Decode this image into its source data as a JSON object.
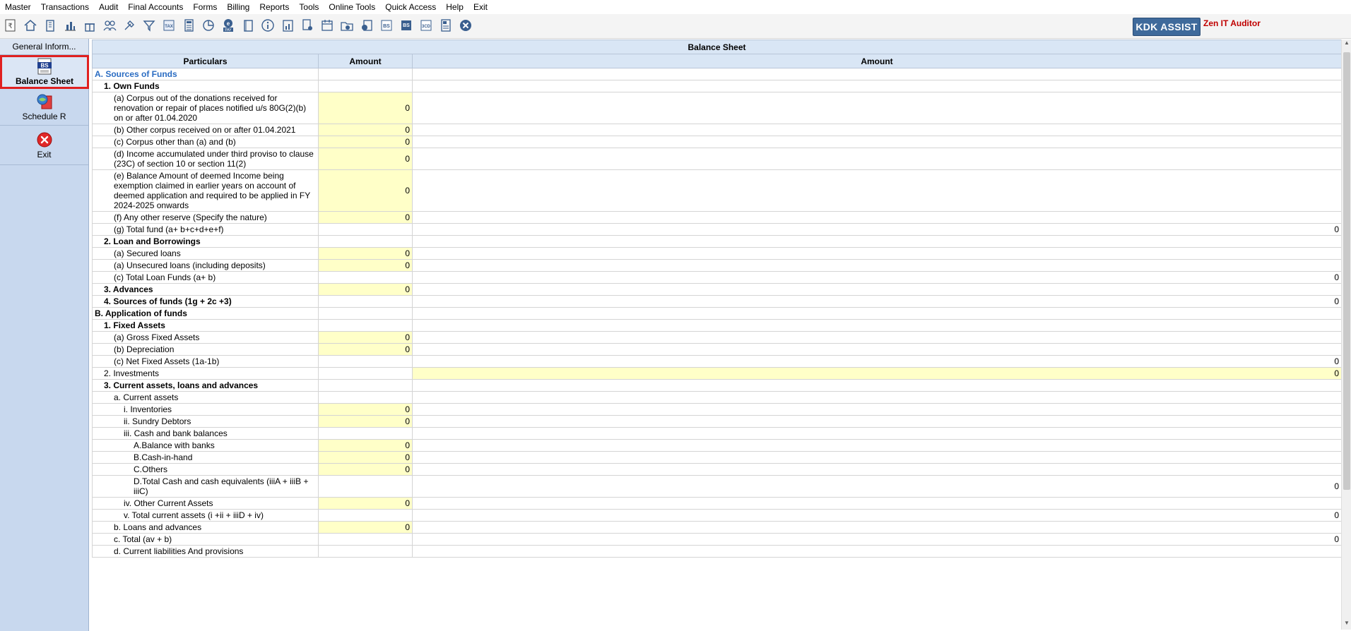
{
  "menu": [
    "Master",
    "Transactions",
    "Audit",
    "Final Accounts",
    "Forms",
    "Billing",
    "Reports",
    "Tools",
    "Online Tools",
    "Quick Access",
    "Help",
    "Exit"
  ],
  "toolbar": {
    "icons": [
      "rupee-doc-icon",
      "home-icon",
      "building-icon",
      "bar-chart-icon",
      "gift-icon",
      "people-icon",
      "tools-icon",
      "filter-icon",
      "tax-icon",
      "calculator-icon",
      "pie-chart-icon",
      "epay-icon",
      "book-icon",
      "info-icon",
      "report-icon",
      "doc-user-icon",
      "calendar-icon",
      "folder-add-icon",
      "refresh-doc-icon",
      "bs-icon",
      "bs-form-icon",
      "3cd-icon",
      "form-icon",
      "close-circle-icon"
    ],
    "tax_text": "TAX",
    "pay_text": "PAY",
    "bs_text": "BS",
    "cd_text": "3CD",
    "kdk_assist": "KDK ASSIST",
    "zen_label": "Zen IT Auditor"
  },
  "sidebar": {
    "header": "General Inform...",
    "items": [
      {
        "label": "Balance Sheet",
        "icon": "balance-sheet-icon",
        "active": true
      },
      {
        "label": "Schedule R",
        "icon": "schedule-r-icon",
        "active": false
      },
      {
        "label": "Exit",
        "icon": "exit-icon",
        "active": false
      }
    ]
  },
  "grid": {
    "title": "Balance Sheet",
    "col_particulars": "Particulars",
    "col_amount1": "Amount",
    "col_amount2": "Amount",
    "rows": [
      {
        "text": "A. Sources of Funds",
        "style": "section",
        "a1": "",
        "a2": "",
        "y1": false,
        "y2": false
      },
      {
        "text": "1. Own Funds",
        "style": "bold l1",
        "a1": "",
        "a2": "",
        "y1": false,
        "y2": false
      },
      {
        "text": "(a) Corpus out of the donations received for renovation or repair of places notified u/s 80G(2)(b) on or after 01.04.2020",
        "style": "l2",
        "a1": "0",
        "a2": "",
        "y1": true,
        "y2": false
      },
      {
        "text": "(b) Other corpus received on or after 01.04.2021",
        "style": "l2",
        "a1": "0",
        "a2": "",
        "y1": true,
        "y2": false
      },
      {
        "text": "(c) Corpus other than (a) and (b)",
        "style": "l2",
        "a1": "0",
        "a2": "",
        "y1": true,
        "y2": false
      },
      {
        "text": "(d) Income accumulated under third proviso to clause (23C) of section 10 or section 11(2)",
        "style": "l2",
        "a1": "0",
        "a2": "",
        "y1": true,
        "y2": false
      },
      {
        "text": "(e) Balance Amount of deemed Income being exemption claimed in earlier years on account of deemed application and required to be applied in FY 2024-2025 onwards",
        "style": "l2",
        "a1": "0",
        "a2": "",
        "y1": true,
        "y2": false
      },
      {
        "text": "(f) Any other reserve (Specify the nature)",
        "style": "l2",
        "a1": "0",
        "a2": "",
        "y1": true,
        "y2": false
      },
      {
        "text": "(g) Total fund (a+ b+c+d+e+f)",
        "style": "l2",
        "a1": "",
        "a2": "0",
        "y1": false,
        "y2": false
      },
      {
        "text": "2. Loan and Borrowings",
        "style": "bold l1",
        "a1": "",
        "a2": "",
        "y1": false,
        "y2": false
      },
      {
        "text": "(a) Secured loans",
        "style": "l2",
        "a1": "0",
        "a2": "",
        "y1": true,
        "y2": false
      },
      {
        "text": "(a) Unsecured loans (including deposits)",
        "style": "l2",
        "a1": "0",
        "a2": "",
        "y1": true,
        "y2": false
      },
      {
        "text": "(c) Total Loan Funds (a+ b)",
        "style": "l2",
        "a1": "",
        "a2": "0",
        "y1": false,
        "y2": false
      },
      {
        "text": "3. Advances",
        "style": "bold l1",
        "a1": "0",
        "a2": "",
        "y1": true,
        "y2": false
      },
      {
        "text": "4. Sources of funds (1g + 2c +3)",
        "style": "bold l1",
        "a1": "",
        "a2": "0",
        "y1": false,
        "y2": false
      },
      {
        "text": "B. Application of funds",
        "style": "bold",
        "a1": "",
        "a2": "",
        "y1": false,
        "y2": false
      },
      {
        "text": "1. Fixed Assets",
        "style": "bold l1",
        "a1": "",
        "a2": "",
        "y1": false,
        "y2": false
      },
      {
        "text": "(a) Gross Fixed Assets",
        "style": "l2",
        "a1": "0",
        "a2": "",
        "y1": true,
        "y2": false
      },
      {
        "text": "(b) Depreciation",
        "style": "l2",
        "a1": "0",
        "a2": "",
        "y1": true,
        "y2": false
      },
      {
        "text": "(c) Net Fixed Assets (1a-1b)",
        "style": "l2",
        "a1": "",
        "a2": "0",
        "y1": false,
        "y2": false
      },
      {
        "text": "2. Investments",
        "style": "l1",
        "a1": "",
        "a2": "0",
        "y1": false,
        "y2": true
      },
      {
        "text": "3. Current assets, loans and advances",
        "style": "bold l1",
        "a1": "",
        "a2": "",
        "y1": false,
        "y2": false
      },
      {
        "text": "a. Current assets",
        "style": "l2",
        "a1": "",
        "a2": "",
        "y1": false,
        "y2": false
      },
      {
        "text": "i. Inventories",
        "style": "l3",
        "a1": "0",
        "a2": "",
        "y1": true,
        "y2": false
      },
      {
        "text": "ii. Sundry Debtors",
        "style": "l3",
        "a1": "0",
        "a2": "",
        "y1": true,
        "y2": false
      },
      {
        "text": "iii. Cash and bank balances",
        "style": "l3",
        "a1": "",
        "a2": "",
        "y1": false,
        "y2": false
      },
      {
        "text": "A.Balance with banks",
        "style": "l4",
        "a1": "0",
        "a2": "",
        "y1": true,
        "y2": false
      },
      {
        "text": "B.Cash-in-hand",
        "style": "l4",
        "a1": "0",
        "a2": "",
        "y1": true,
        "y2": false
      },
      {
        "text": "C.Others",
        "style": "l4",
        "a1": "0",
        "a2": "",
        "y1": true,
        "y2": false
      },
      {
        "text": "D.Total Cash and cash equivalents (iiiA + iiiB + iiiC)",
        "style": "l4",
        "a1": "",
        "a2": "0",
        "y1": false,
        "y2": false
      },
      {
        "text": "iv. Other Current Assets",
        "style": "l3",
        "a1": "0",
        "a2": "",
        "y1": true,
        "y2": false
      },
      {
        "text": "v. Total current assets (i +ii + iiiD + iv)",
        "style": "l3",
        "a1": "",
        "a2": "0",
        "y1": false,
        "y2": false
      },
      {
        "text": "b. Loans and advances",
        "style": "l2",
        "a1": "0",
        "a2": "",
        "y1": true,
        "y2": false
      },
      {
        "text": "c. Total (av + b)",
        "style": "l2",
        "a1": "",
        "a2": "0",
        "y1": false,
        "y2": false
      },
      {
        "text": "d. Current liabilities And provisions",
        "style": "l2",
        "a1": "",
        "a2": "",
        "y1": false,
        "y2": false
      }
    ]
  }
}
